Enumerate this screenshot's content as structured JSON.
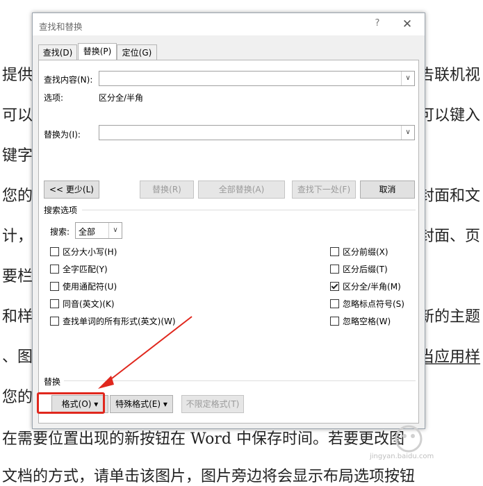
{
  "document": {
    "lines": [
      "提供",
      "告联机视",
      "可以",
      "可以键入",
      "键字",
      "您的",
      "封面和文",
      "计，",
      "封面、页",
      "要栏",
      "和样",
      "新的主题",
      "、图",
      "当应用样",
      "您的",
      "在需要位置出现的新按钮在 Word 中保存时间。若要更改图",
      "文档的方式，请单击该图片，图片旁边将会显示布局选项按钮"
    ]
  },
  "dialog": {
    "title": "查找和替换",
    "help": "?",
    "close": "✕",
    "tabs": [
      "查找(D)",
      "替换(P)",
      "定位(G)"
    ],
    "active_tab": "替换(P)",
    "find_label": "查找内容(N):",
    "find_value": "",
    "options_label": "选项:",
    "options_value": "区分全/半角",
    "replace_label": "替换为(I):",
    "replace_value": "",
    "buttons": {
      "less": "<< 更少(L)",
      "replace": "替换(R)",
      "replace_all": "全部替换(A)",
      "find_next": "查找下一处(F)",
      "cancel": "取消"
    },
    "search_options_title": "搜索选项",
    "search_label": "搜索:",
    "search_value": "全部",
    "left_checks": [
      {
        "label": "区分大小写(H)",
        "checked": false
      },
      {
        "label": "全字匹配(Y)",
        "checked": false
      },
      {
        "label": "使用通配符(U)",
        "checked": false
      },
      {
        "label": "同音(英文)(K)",
        "checked": false
      },
      {
        "label": "查找单词的所有形式(英文)(W)",
        "checked": false
      }
    ],
    "right_checks": [
      {
        "label": "区分前缀(X)",
        "checked": false
      },
      {
        "label": "区分后缀(T)",
        "checked": false
      },
      {
        "label": "区分全/半角(M)",
        "checked": true
      },
      {
        "label": "忽略标点符号(S)",
        "checked": false
      },
      {
        "label": "忽略空格(W)",
        "checked": false
      }
    ],
    "replace_section_title": "替换",
    "format_buttons": {
      "format": "格式(O) ▾",
      "special": "特殊格式(E) ▾",
      "no_format": "不限定格式(T)"
    }
  },
  "annotation": {
    "color": "#e0271d"
  },
  "watermark": {
    "text": "jingyan.baidu.com"
  }
}
